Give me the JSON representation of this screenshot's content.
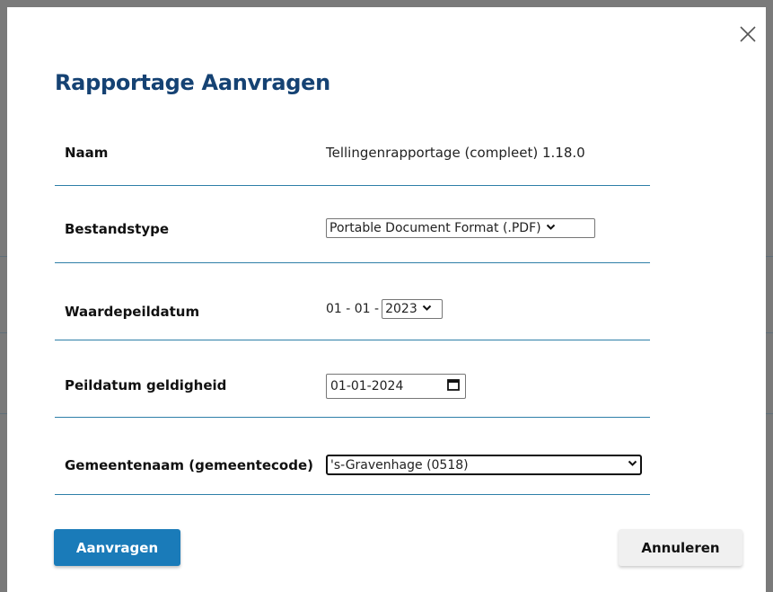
{
  "dialog": {
    "title": "Rapportage Aanvragen",
    "close_icon": "close-icon"
  },
  "form": {
    "naam": {
      "label": "Naam",
      "value": "Tellingenrapportage (compleet) 1.18.0"
    },
    "bestandstype": {
      "label": "Bestandstype",
      "selected": "Portable Document Format (.PDF)"
    },
    "waardepeildatum": {
      "label": "Waardepeildatum",
      "prefix": "01 - 01 -",
      "year_selected": "2023"
    },
    "peildatum_geldigheid": {
      "label": "Peildatum geldigheid",
      "value": "01-01-2024",
      "icon": "calendar-icon"
    },
    "gemeente": {
      "label": "Gemeentenaam (gemeentecode)",
      "selected": "'s-Gravenhage (0518)"
    }
  },
  "buttons": {
    "submit_label": "Aanvragen",
    "cancel_label": "Annuleren"
  },
  "colors": {
    "title": "#154273",
    "divider": "#2e7fa8",
    "primary_button": "#1a7bb9",
    "secondary_button": "#f0f0f0"
  }
}
